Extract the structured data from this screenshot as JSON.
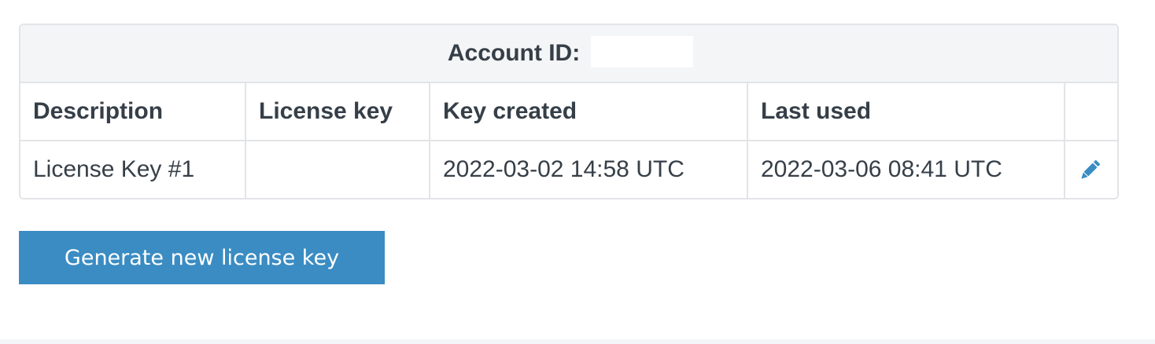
{
  "account": {
    "label": "Account ID:",
    "value": ""
  },
  "table": {
    "columns": [
      "Description",
      "License key",
      "Key created",
      "Last used",
      ""
    ],
    "rows": [
      {
        "description": "License Key #1",
        "license_key": "",
        "key_created": "2022-03-02 14:58 UTC",
        "last_used": "2022-03-06 08:41 UTC",
        "action_icon": "pencil-icon"
      }
    ]
  },
  "actions": {
    "generate_label": "Generate new license key"
  },
  "colors": {
    "accent": "#3a8cc3",
    "text": "#363f48",
    "border": "#e2e4e7",
    "header_bg": "#f4f5f6"
  }
}
